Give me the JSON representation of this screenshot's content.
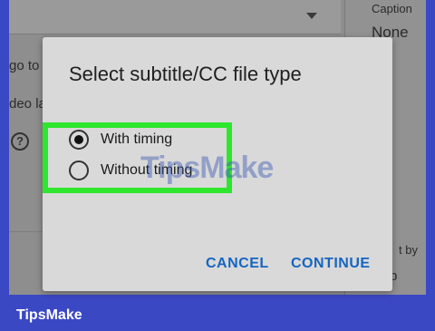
{
  "background": {
    "partial_top_left": "go to",
    "partial_mid_left": "deo la",
    "help_icon_glyph": "?",
    "caption_partial": "Caption",
    "caption_value": "None",
    "right_partial_a": "t by",
    "right_partial_b": "p"
  },
  "dialog": {
    "title": "Select subtitle/CC file type",
    "options": [
      {
        "label": "With timing",
        "selected": true
      },
      {
        "label": "Without timing",
        "selected": false
      }
    ],
    "cancel_label": "CANCEL",
    "continue_label": "CONTINUE"
  },
  "colors": {
    "accent": "#1565c0",
    "highlight": "#2ee62e",
    "frame": "#3b48c4"
  },
  "watermark": "TipsMake",
  "brand": "TipsMake"
}
